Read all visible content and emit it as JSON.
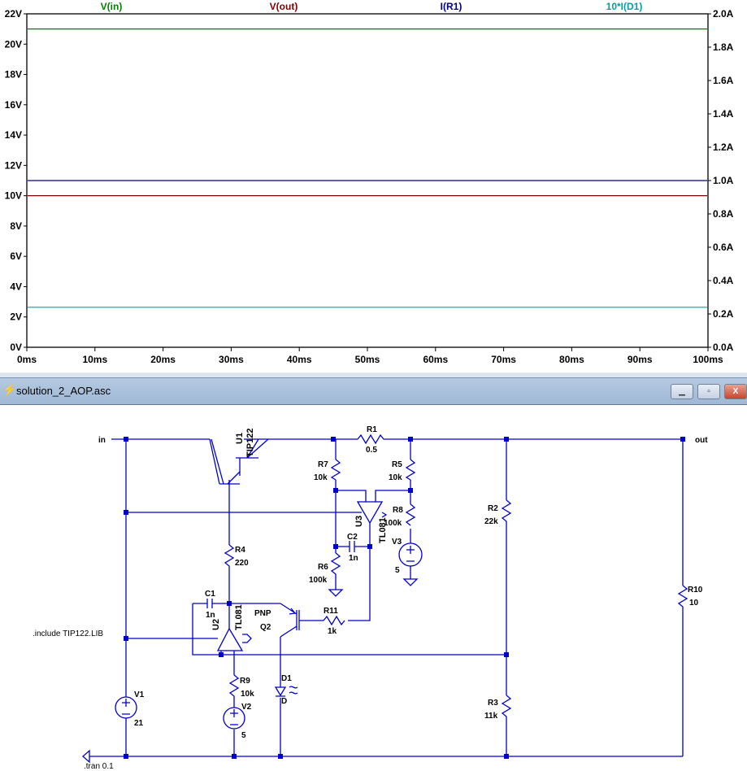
{
  "plot": {
    "traces": [
      {
        "label": "V(in)",
        "color": "#007f00",
        "axis": "left",
        "value": 21
      },
      {
        "label": "V(out)",
        "color": "#7f0000",
        "axis": "left",
        "value": 10
      },
      {
        "label": "I(R1)",
        "color": "#00007f",
        "axis": "right",
        "value": 1.0
      },
      {
        "label": "10*I(D1)",
        "color": "#00a0a0",
        "axis": "right",
        "value": 0.24
      }
    ],
    "left_ticks": [
      "0V",
      "2V",
      "4V",
      "6V",
      "8V",
      "10V",
      "12V",
      "14V",
      "16V",
      "18V",
      "20V",
      "22V"
    ],
    "right_ticks": [
      "0.0A",
      "0.2A",
      "0.4A",
      "0.6A",
      "0.8A",
      "1.0A",
      "1.2A",
      "1.4A",
      "1.6A",
      "1.8A",
      "2.0A"
    ],
    "x_ticks": [
      "0ms",
      "10ms",
      "20ms",
      "30ms",
      "40ms",
      "50ms",
      "60ms",
      "70ms",
      "80ms",
      "90ms",
      "100ms"
    ],
    "left_range": [
      0,
      22
    ],
    "right_range": [
      0,
      2.0
    ],
    "x_range": [
      0,
      100
    ]
  },
  "window": {
    "title": "solution_2_AOP.asc",
    "icon": "ltspice-schematic-icon",
    "minimize": "▁",
    "maximize": "▫",
    "close": "X"
  },
  "schematic": {
    "net_in": "in",
    "net_out": "out",
    "U1": {
      "name": "U1",
      "model": "TIP122"
    },
    "R1": {
      "name": "R1",
      "value": "0.5"
    },
    "R2": {
      "name": "R2",
      "value": "22k"
    },
    "R3": {
      "name": "R3",
      "value": "11k"
    },
    "R4": {
      "name": "R4",
      "value": "220"
    },
    "R5": {
      "name": "R5",
      "value": "10k"
    },
    "R6": {
      "name": "R6",
      "value": "100k"
    },
    "R7": {
      "name": "R7",
      "value": "10k"
    },
    "R8": {
      "name": "R8",
      "value": "100k"
    },
    "R9": {
      "name": "R9",
      "value": "10k"
    },
    "R10": {
      "name": "R10",
      "value": "10"
    },
    "R11": {
      "name": "R11",
      "value": "1k"
    },
    "C1": {
      "name": "C1",
      "value": "1n"
    },
    "C2": {
      "name": "C2",
      "value": "1n"
    },
    "U2": {
      "name": "U2",
      "model": "TL081"
    },
    "U3": {
      "name": "U3",
      "model": "TL081"
    },
    "Q2": {
      "name": "Q2",
      "model": "PNP"
    },
    "D1": {
      "name": "D1",
      "model": "D"
    },
    "V1": {
      "name": "V1",
      "value": "21"
    },
    "V2": {
      "name": "V2",
      "value": "5"
    },
    "V3": {
      "name": "V3",
      "value": "5"
    },
    "include": ".include TIP122.LIB",
    "tran": ".tran 0.1"
  }
}
